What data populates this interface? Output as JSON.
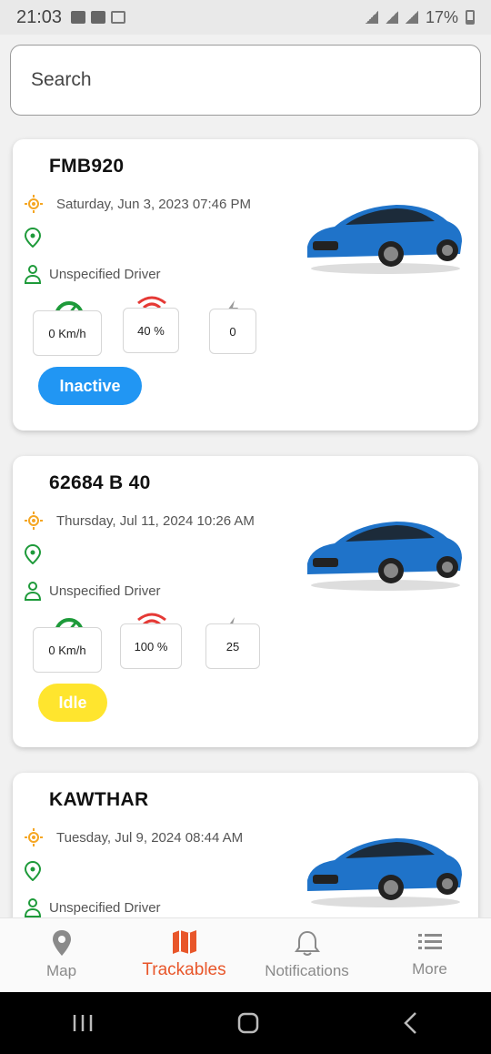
{
  "status_bar": {
    "time": "21:03",
    "battery": "17%"
  },
  "search": {
    "placeholder": "Search"
  },
  "trackables": [
    {
      "name": "FMB920",
      "datetime": "Saturday, Jun 3, 2023 07:46 PM",
      "location": "",
      "driver": "Unspecified Driver",
      "speed": "0 Km/h",
      "signal": "40 %",
      "power": "0",
      "status": "Inactive"
    },
    {
      "name": "62684 B 40",
      "datetime": "Thursday, Jul 11, 2024 10:26 AM",
      "location": "",
      "driver": "Unspecified Driver",
      "speed": "0 Km/h",
      "signal": "100 %",
      "power": "25",
      "status": "Idle"
    },
    {
      "name": "KAWTHAR",
      "datetime": "Tuesday, Jul 9, 2024 08:44 AM",
      "location": "",
      "driver": "Unspecified Driver"
    }
  ],
  "bottom_nav": [
    {
      "label": "Map",
      "icon": "map-pin-icon",
      "active": false
    },
    {
      "label": "Trackables",
      "icon": "folded-map-icon",
      "active": true
    },
    {
      "label": "Notifications",
      "icon": "bell-icon",
      "active": false
    },
    {
      "label": "More",
      "icon": "list-icon",
      "active": false
    }
  ],
  "colors": {
    "accent": "#e8562a",
    "inactive": "#2196f3",
    "idle": "#ffe52e",
    "speed_icon": "#1e9a3a",
    "signal_icon": "#e53935",
    "time_icon": "#f5a623",
    "location_icon": "#1e9a3a"
  }
}
